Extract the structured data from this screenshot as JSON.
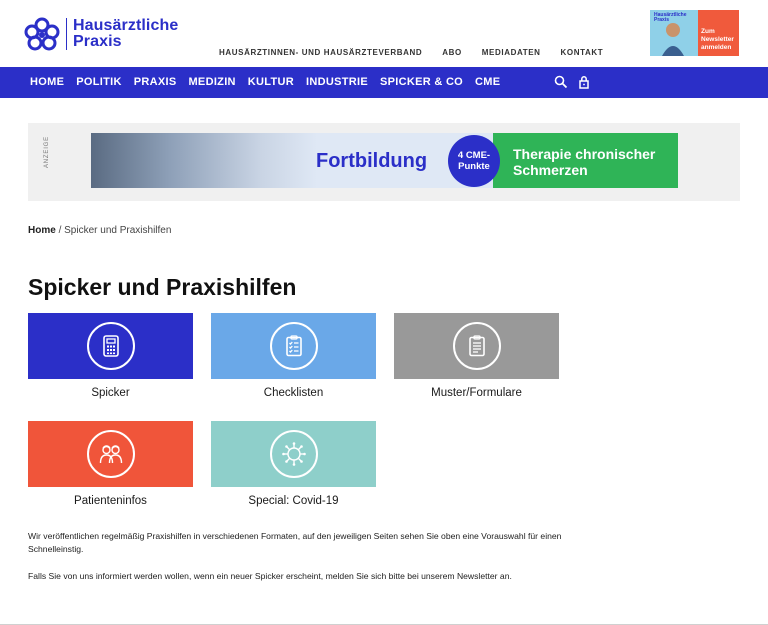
{
  "brand": {
    "line1": "Hausärztliche",
    "line2": "Praxis",
    "color": "#2b2fc8"
  },
  "topnav": [
    "HAUSÄRZTINNEN- UND HAUSÄRZTEVERBAND",
    "ABO",
    "MEDIADATEN",
    "KONTAKT"
  ],
  "promo": {
    "brand_line1": "Hausärztliche",
    "brand_line2": "Praxis",
    "text_line1": "Zum",
    "text_line2": "Newsletter",
    "text_line3": "anmelden"
  },
  "mainnav": {
    "items": [
      "HOME",
      "POLITIK",
      "PRAXIS",
      "MEDIZIN",
      "KULTUR",
      "INDUSTRIE",
      "SPICKER & CO",
      "CME"
    ],
    "search_icon": "search-icon",
    "lock_icon": "lock-icon"
  },
  "ad": {
    "label": "ANZEIGE",
    "title": "Fortbildung",
    "badge_line1": "4 CME-",
    "badge_line2": "Punkte",
    "subtitle_line1": "Therapie chronischer",
    "subtitle_line2": "Schmerzen"
  },
  "breadcrumb": {
    "home": "Home",
    "separator": " / ",
    "current": "Spicker und Praxishilfen"
  },
  "page_title": "Spicker und Praxishilfen",
  "tiles": [
    {
      "label": "Spicker",
      "icon": "calculator-icon",
      "color": "#2b2fc8"
    },
    {
      "label": "Checklisten",
      "icon": "checklist-icon",
      "color": "#6aa8e8"
    },
    {
      "label": "Muster/Formulare",
      "icon": "clipboard-icon",
      "color": "#999999"
    },
    {
      "label": "Patienteninfos",
      "icon": "patients-icon",
      "color": "#f0553a"
    },
    {
      "label": "Special: Covid-19",
      "icon": "virus-icon",
      "color": "#8ecfca"
    }
  ],
  "paragraphs": [
    "Wir veröffentlichen regelmäßig Praxishilfen in verschiedenen Formaten, auf den jeweiligen Seiten sehen Sie oben eine Vorauswahl für einen Schnelleinstig.",
    "Falls Sie von uns informiert werden wollen, wenn ein neuer Spicker erscheint, melden Sie sich bitte bei unserem Newsletter an."
  ]
}
